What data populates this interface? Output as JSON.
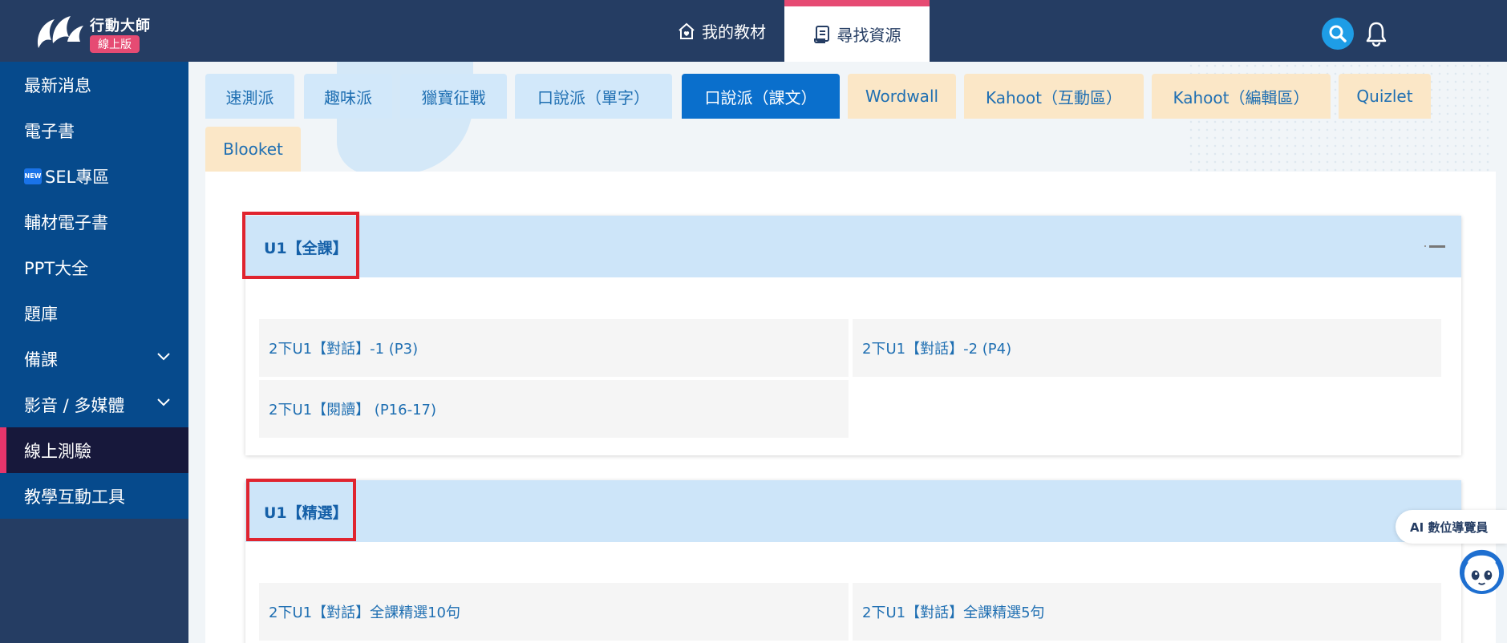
{
  "header": {
    "logo_title": "行動大師",
    "logo_badge": "線上版",
    "nav": [
      {
        "label": "我的教材",
        "icon": "house-heart-icon"
      },
      {
        "label": "尋找資源",
        "icon": "scroll-icon",
        "active": true
      }
    ],
    "search_icon": "search-icon",
    "bell_icon": "bell-icon"
  },
  "sidebar": {
    "items": [
      {
        "label": "最新消息"
      },
      {
        "label": "電子書"
      },
      {
        "label": "SEL專區",
        "badge": "NEW"
      },
      {
        "label": "輔材電子書"
      },
      {
        "label": "PPT大全"
      },
      {
        "label": "題庫"
      },
      {
        "label": "備課",
        "expandable": true
      },
      {
        "label": "影音 / 多媒體",
        "expandable": true
      },
      {
        "label": "線上測驗",
        "active": true
      },
      {
        "label": "教學互動工具"
      }
    ]
  },
  "tabs": [
    {
      "label": "速測派",
      "style": "blue"
    },
    {
      "label": "趣味派",
      "style": "blue"
    },
    {
      "label": "獵寶征戰",
      "style": "blue"
    },
    {
      "label": "口說派（單字）",
      "style": "blue"
    },
    {
      "label": "口說派（課文）",
      "style": "active"
    },
    {
      "label": "Wordwall",
      "style": "orange"
    },
    {
      "label": "Kahoot（互動區）",
      "style": "orange"
    },
    {
      "label": "Kahoot（編輯區）",
      "style": "orange"
    },
    {
      "label": "Quizlet",
      "style": "orange"
    },
    {
      "label": "Blooket",
      "style": "orange"
    }
  ],
  "sections": [
    {
      "title": "U1【全課】",
      "items": [
        "2下U1【對話】-1 (P3)",
        "2下U1【對話】-2 (P4)",
        "2下U1【閱讀】 (P16-17)"
      ]
    },
    {
      "title": "U1【精選】",
      "items": [
        "2下U1【對話】全課精選10句",
        "2下U1【對話】全課精選5句"
      ]
    }
  ],
  "ai_guide": {
    "label": "AI 數位導覽員"
  },
  "colors": {
    "header": "#253d63",
    "sidebar_item": "#064a8c",
    "accent": "#e64b73",
    "active_tab": "#0a6fcc"
  }
}
